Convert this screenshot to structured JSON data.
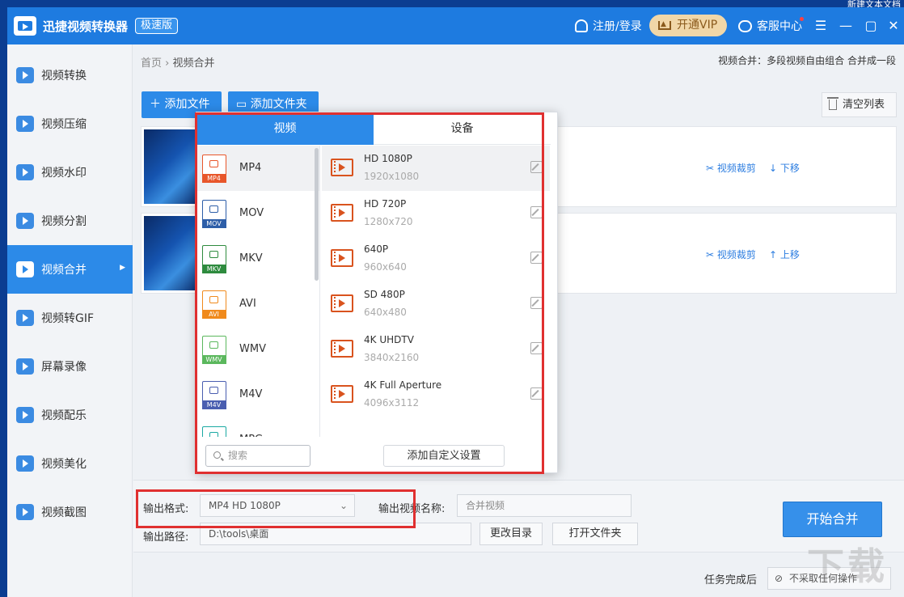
{
  "desktop": {
    "title": "新建文本文档"
  },
  "app": {
    "title": "迅捷视频转换器",
    "badge": "极速版"
  },
  "header": {
    "login": "注册/登录",
    "vip": "开通VIP",
    "support": "客服中心"
  },
  "sidebar": {
    "items": [
      {
        "label": "视频转换",
        "active": false
      },
      {
        "label": "视频压缩",
        "active": false
      },
      {
        "label": "视频水印",
        "active": false
      },
      {
        "label": "视频分割",
        "active": false
      },
      {
        "label": "视频合并",
        "active": true
      },
      {
        "label": "视频转GIF",
        "active": false
      },
      {
        "label": "屏幕录像",
        "active": false
      },
      {
        "label": "视频配乐",
        "active": false
      },
      {
        "label": "视频美化",
        "active": false
      },
      {
        "label": "视频截图",
        "active": false
      }
    ]
  },
  "breadcrumb": {
    "home": "首页",
    "sep": "›",
    "current": "视频合并"
  },
  "hint": "视频合并：多段视频自由组合 合并成一段",
  "toolbar": {
    "add_file": "添加文件",
    "add_folder": "添加文件夹",
    "clear": "清空列表"
  },
  "rows": [
    {
      "crop": "视频裁剪",
      "move": "下移"
    },
    {
      "crop": "视频裁剪",
      "move": "上移"
    }
  ],
  "popup": {
    "tab_video": "视频",
    "tab_device": "设备",
    "formats": [
      {
        "name": "MP4",
        "tag": "MP4",
        "color": "#e8562a"
      },
      {
        "name": "MOV",
        "tag": "MOV",
        "color": "#2d5ea8"
      },
      {
        "name": "MKV",
        "tag": "MKV",
        "color": "#2e8b3e"
      },
      {
        "name": "AVI",
        "tag": "AVI",
        "color": "#f08a1c"
      },
      {
        "name": "WMV",
        "tag": "WMV",
        "color": "#5bb85d"
      },
      {
        "name": "M4V",
        "tag": "M4V",
        "color": "#4a5eb0"
      },
      {
        "name": "MPG",
        "tag": "MPG",
        "color": "#1ba9a3"
      }
    ],
    "presets": [
      {
        "name": "HD 1080P",
        "res": "1920x1080"
      },
      {
        "name": "HD 720P",
        "res": "1280x720"
      },
      {
        "name": "640P",
        "res": "960x640"
      },
      {
        "name": "SD 480P",
        "res": "640x480"
      },
      {
        "name": "4K UHDTV",
        "res": "3840x2160"
      },
      {
        "name": "4K Full Aperture",
        "res": "4096x3112"
      }
    ],
    "search_placeholder": "搜索",
    "custom_btn": "添加自定义设置"
  },
  "settings": {
    "format_label": "输出格式:",
    "format_value": "MP4  HD 1080P",
    "name_label": "输出视频名称:",
    "name_value": "合并视频",
    "path_label": "输出路径:",
    "path_value": "D:\\tools\\桌面",
    "change_dir": "更改目录",
    "open_folder": "打开文件夹",
    "start": "开始合并"
  },
  "footer": {
    "after_label": "任务完成后",
    "after_value": "不采取任何操作"
  },
  "watermark": "下载",
  "colors": {
    "primary": "#2c8ae8",
    "titlebar": "#1e7be0",
    "highlight": "#e03030"
  }
}
